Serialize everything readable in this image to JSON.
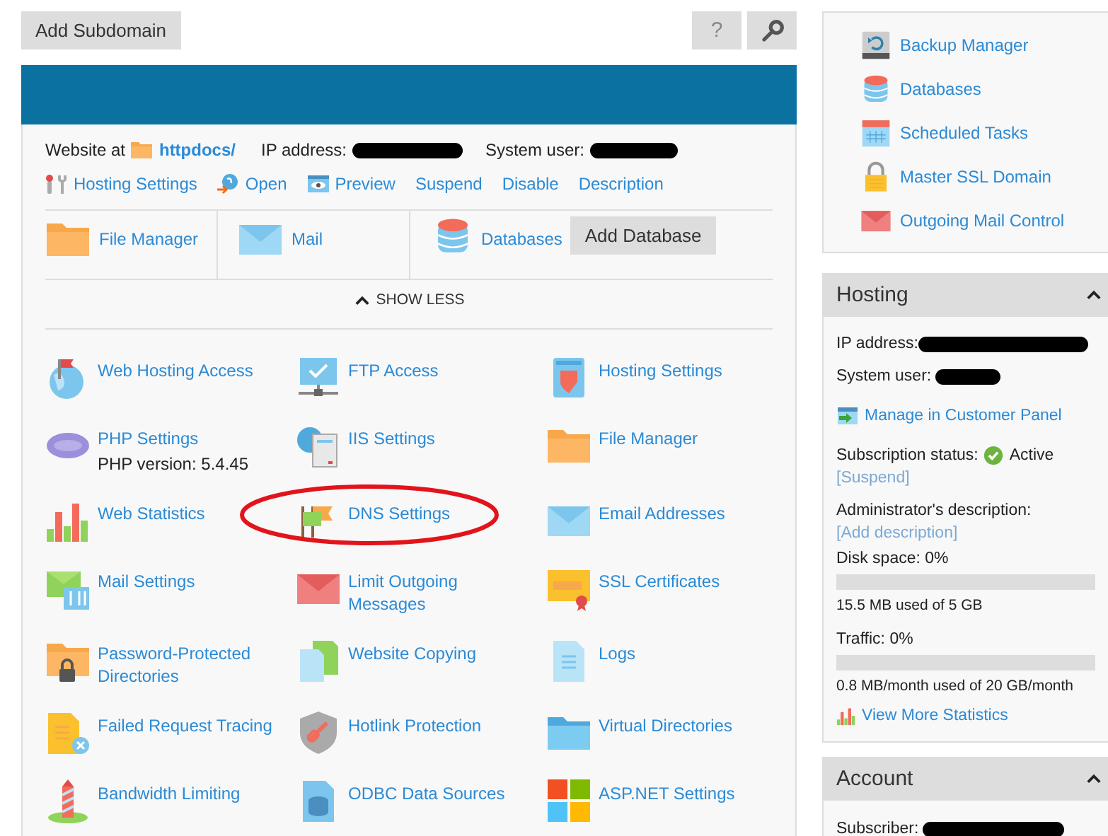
{
  "toolbar": {
    "add_subdomain": "Add Subdomain",
    "help": "?"
  },
  "website": {
    "label": "Website at",
    "folder_link": "httpdocs/",
    "ip_label": "IP address:",
    "ip_redacted": true,
    "user_label": "System user:",
    "user_redacted": true
  },
  "actions": [
    {
      "label": "Hosting Settings"
    },
    {
      "label": "Open"
    },
    {
      "label": "Preview"
    },
    {
      "label": "Suspend"
    },
    {
      "label": "Disable"
    },
    {
      "label": "Description"
    }
  ],
  "quick": [
    {
      "label": "File Manager"
    },
    {
      "label": "Mail"
    },
    {
      "label": "Databases",
      "button": "Add Database"
    }
  ],
  "toggle": {
    "label": "SHOW LESS",
    "expanded": true
  },
  "tools": [
    {
      "label": "Web Hosting Access"
    },
    {
      "label": "FTP Access"
    },
    {
      "label": "Hosting Settings"
    },
    {
      "label": "PHP Settings",
      "note": "PHP version: 5.4.45"
    },
    {
      "label": "IIS Settings"
    },
    {
      "label": "File Manager"
    },
    {
      "label": "Web Statistics"
    },
    {
      "label": "DNS Settings",
      "highlighted": true
    },
    {
      "label": "Email Addresses"
    },
    {
      "label": "Mail Settings"
    },
    {
      "label": "Limit Outgoing Messages"
    },
    {
      "label": "SSL Certificates"
    },
    {
      "label": "Password-Protected Directories"
    },
    {
      "label": "Website Copying"
    },
    {
      "label": "Logs"
    },
    {
      "label": "Failed Request Tracing"
    },
    {
      "label": "Hotlink Protection"
    },
    {
      "label": "Virtual Directories"
    },
    {
      "label": "Bandwidth Limiting"
    },
    {
      "label": "ODBC Data Sources"
    },
    {
      "label": "ASP.NET Settings"
    }
  ],
  "side_links": [
    {
      "label": "Backup Manager"
    },
    {
      "label": "Databases"
    },
    {
      "label": "Scheduled Tasks"
    },
    {
      "label": "Master SSL Domain"
    },
    {
      "label": "Outgoing Mail Control"
    }
  ],
  "hosting": {
    "title": "Hosting",
    "expanded": true,
    "ip_label": "IP address:",
    "ip_redacted": true,
    "user_label": "System user:",
    "user_redacted": true,
    "manage_link": "Manage in Customer Panel",
    "status_label": "Subscription status:",
    "status": "Active",
    "suspend_link": "[Suspend]",
    "desc_label": "Administrator's description:",
    "desc_link": "[Add description]",
    "disk_label": "Disk space: 0%",
    "disk": {
      "level": 0
    },
    "disk_reading": "15.5 MB used of 5 GB",
    "traffic_label": "Traffic: 0%",
    "traffic": {
      "level": 0
    },
    "traffic_reading": "0.8 MB/month used of 20 GB/month",
    "stats_link": "View More Statistics"
  },
  "account": {
    "title": "Account",
    "expanded": true,
    "subscriber_label": "Subscriber:",
    "subscriber_redacted": true
  }
}
